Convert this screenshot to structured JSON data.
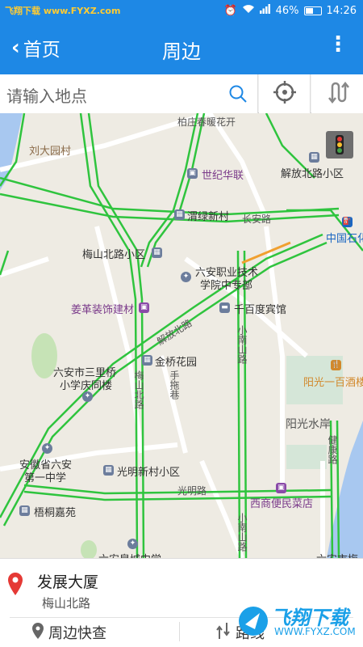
{
  "status_bar": {
    "left_text": "飞翔下载 www.FYXZ.com",
    "battery": "46%",
    "time": "14:26",
    "battery_level": 0.46
  },
  "app_bar": {
    "back_label": "首页",
    "title": "周边",
    "menu_icon": "more-vertical-icon"
  },
  "search": {
    "placeholder": "请输入地点"
  },
  "map": {
    "labels": {
      "baizhuang": "柏庄春暖花开",
      "liudayuan": "刘大园村",
      "shijihualian": "世纪华联",
      "jiefangbeilu": "解放北路小区",
      "weilvxincun": "渭绿新村",
      "changanlu": "长安路",
      "zhongguoshihua": "中国石化",
      "meishanbeilu_xq": "梅山北路小区",
      "liuan_zhiye1": "六安职业技术",
      "liuan_zhiye2": "学院中专部",
      "jiangge": "姜革装饰建材",
      "qianbaidu": "千百度宾馆",
      "jiefanglu": "解放北路",
      "xiaonanshanlu": "小南山路",
      "jinqiao": "金桥花园",
      "sanlidian1": "六安市三里桥",
      "sanlidian2": "小学庆同楼",
      "meishanbeilu": "梅山北路",
      "shoutuoxiang": "手拖巷",
      "yangguang_hotel": "阳光一百酒楼",
      "yangguang_shuian": "阳光水岸",
      "jiankanglu": "健康路",
      "anhui_1": "安徽省六安",
      "anhui_2": "第一中学",
      "guangming_xq": "光明新村小区",
      "guangminglu": "光明路",
      "xishang": "西商便民菜店",
      "wutong": "梧桐嘉苑",
      "xiaonanshanlu2": "小南山路",
      "bottom_cut1": "六安皋城中学",
      "bottom_cut2": "六安市梅"
    }
  },
  "place": {
    "name": "发展大厦",
    "address": "梅山北路"
  },
  "actions": {
    "nearby": "周边快查",
    "route": "路线"
  },
  "watermark": {
    "text": "飞翔下载",
    "url": "WWW.FYXZ.COM"
  },
  "colors": {
    "primary": "#1e88e5",
    "road_green": "#2fc43e",
    "pin_red": "#e53935",
    "map_bg": "#eeebe3"
  }
}
